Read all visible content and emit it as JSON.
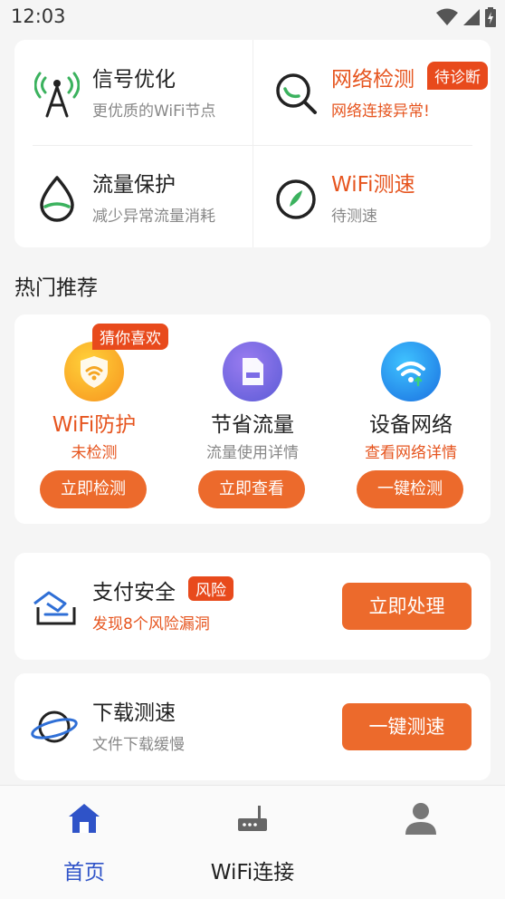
{
  "status_bar": {
    "time": "12:03"
  },
  "features": [
    {
      "title": "信号优化",
      "subtitle": "更优质的WiFi节点",
      "icon": "signal-tower-icon"
    },
    {
      "title": "网络检测",
      "subtitle": "网络连接异常!",
      "badge": "待诊断",
      "icon": "magnifier-icon"
    },
    {
      "title": "流量保护",
      "subtitle": "减少异常流量消耗",
      "icon": "water-drop-icon"
    },
    {
      "title": "WiFi测速",
      "subtitle": "待测速",
      "icon": "speed-gauge-icon"
    }
  ],
  "section_title": "热门推荐",
  "recommend": [
    {
      "title": "WiFi防护",
      "subtitle": "未检测",
      "button": "立即检测",
      "tag": "猜你喜欢",
      "icon": "wifi-shield-icon"
    },
    {
      "title": "节省流量",
      "subtitle": "流量使用详情",
      "button": "立即查看",
      "icon": "document-icon"
    },
    {
      "title": "设备网络",
      "subtitle": "查看网络详情",
      "button": "一键检测",
      "icon": "wifi-globe-icon"
    }
  ],
  "pay_security": {
    "title": "支付安全",
    "tag": "风险",
    "subtitle": "发现8个风险漏洞",
    "button": "立即处理",
    "icon": "payment-card-icon"
  },
  "download_speed": {
    "title": "下载测速",
    "subtitle": "文件下载缓慢",
    "button": "一键测速",
    "icon": "planet-icon"
  },
  "nav": [
    {
      "label": "首页",
      "icon": "home-icon",
      "active": true
    },
    {
      "label": "WiFi连接",
      "icon": "router-icon"
    },
    {
      "label": "",
      "icon": "user-icon"
    }
  ],
  "colors": {
    "accent": "#ec6a2c",
    "badge": "#e84a1c",
    "nav_active": "#2f53c8"
  }
}
